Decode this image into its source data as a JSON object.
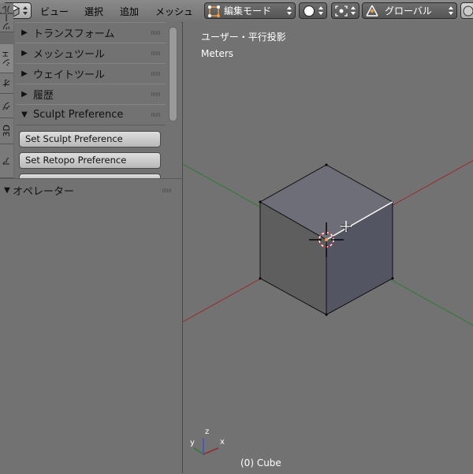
{
  "header": {
    "menu": [
      "ビュー",
      "選択",
      "追加",
      "メッシュ"
    ],
    "mode": "編集モード",
    "orientation": "グローバル",
    "icons": {
      "editor_type": "cube-icon",
      "mode": "edit-mode-icon",
      "shading": "solid-sphere-icon",
      "pivot": "pivot-point-icon",
      "transform": "transform-manipulator-icon",
      "extra": "sphere-icon"
    }
  },
  "tool_shelf": {
    "tabs": [
      "ツール",
      "作成",
      "シェ",
      "オ",
      "グ",
      "3D",
      "ア"
    ],
    "panels": [
      {
        "label": "トランスフォーム",
        "expanded": false
      },
      {
        "label": "メッシュツール",
        "expanded": false
      },
      {
        "label": "ウェイトツール",
        "expanded": false
      },
      {
        "label": "履歴",
        "expanded": false
      },
      {
        "label": "Sculpt Preference",
        "expanded": true
      }
    ],
    "buttons": [
      "Set Sculpt Preference",
      "Set Retopo Preference"
    ]
  },
  "operator_panel": {
    "label": "オペレーター"
  },
  "viewport": {
    "view_name": "ユーザー・平行投影",
    "units": "Meters",
    "object_info": "(0) Cube",
    "axis_labels": {
      "x": "x",
      "y": "y",
      "z": "z"
    },
    "colors": {
      "x_axis": "#9a2a2a",
      "y_axis": "#2f7a2f",
      "z_axis": "#3b52c8",
      "selected_edge": "#ffffff"
    }
  }
}
